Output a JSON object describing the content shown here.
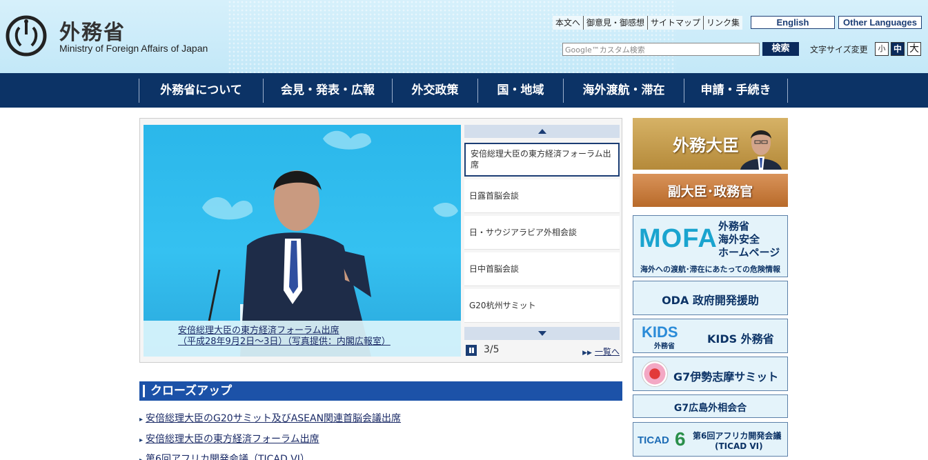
{
  "header": {
    "title_ja": "外務省",
    "title_en": "Ministry of Foreign Affairs of Japan",
    "util_links": [
      "本文へ",
      "御意見・御感想",
      "サイトマップ",
      "リンク集"
    ],
    "lang_english": "English",
    "lang_other": "Other Languages",
    "search_placeholder": "Google™カスタム検索",
    "search_button": "検索",
    "font_size_label": "文字サイズ変更",
    "font_size_small": "小",
    "font_size_mid": "中",
    "font_size_large": "大"
  },
  "nav": {
    "items": [
      "外務省について",
      "会見・発表・広報",
      "外交政策",
      "国・地域",
      "海外渡航・滞在",
      "申請・手続き"
    ]
  },
  "slideshow": {
    "caption_line1": "安倍総理大臣の東方経済フォーラム出席",
    "caption_line2": "（平成28年9月2日〜3日）（写真提供：内閣広報室）",
    "items": [
      "安倍総理大臣の東方経済フォーラム出席",
      "日露首脳会談",
      "日・サウジアラビア外相会談",
      "日中首脳会談",
      "G20杭州サミット"
    ],
    "counter": "3/5",
    "list_link": "一覧へ"
  },
  "closeup": {
    "heading": "クローズアップ",
    "items": [
      "安倍総理大臣のG20サミット及びASEAN関連首脳会議出席",
      "安倍総理大臣の東方経済フォーラム出席",
      "第6回アフリカ開発会議（TICAD VI）"
    ]
  },
  "banners": {
    "minister": "外務大臣",
    "vice": "副大臣･政務官",
    "mofa_logo": "MOFA",
    "mofa_ja_line1": "外務省",
    "mofa_ja_line2": "海外安全",
    "mofa_ja_line3": "ホームページ",
    "mofa_strip": "海外への渡航･滞在にあたっての危険情報",
    "oda": "ODA 政府開発援助",
    "kids_logo": "KIDS",
    "kids_sub": "外務省",
    "kids_label": "KIDS 外務省",
    "g7_ise": "G7伊勢志摩サミット",
    "g7_hiroshima": "G7広島外相会合",
    "ticad_logo": "TICAD",
    "ticad_six": "6",
    "ticad_line1": "第6回アフリカ開発会議",
    "ticad_line2": "(TICAD VI)"
  },
  "colors": {
    "navy": "#0c3366",
    "closeup_blue": "#1c52a8",
    "header_sky": "#c3e8f8",
    "minister_gold": "#c79a4a",
    "vice_orange": "#c87a3a"
  }
}
